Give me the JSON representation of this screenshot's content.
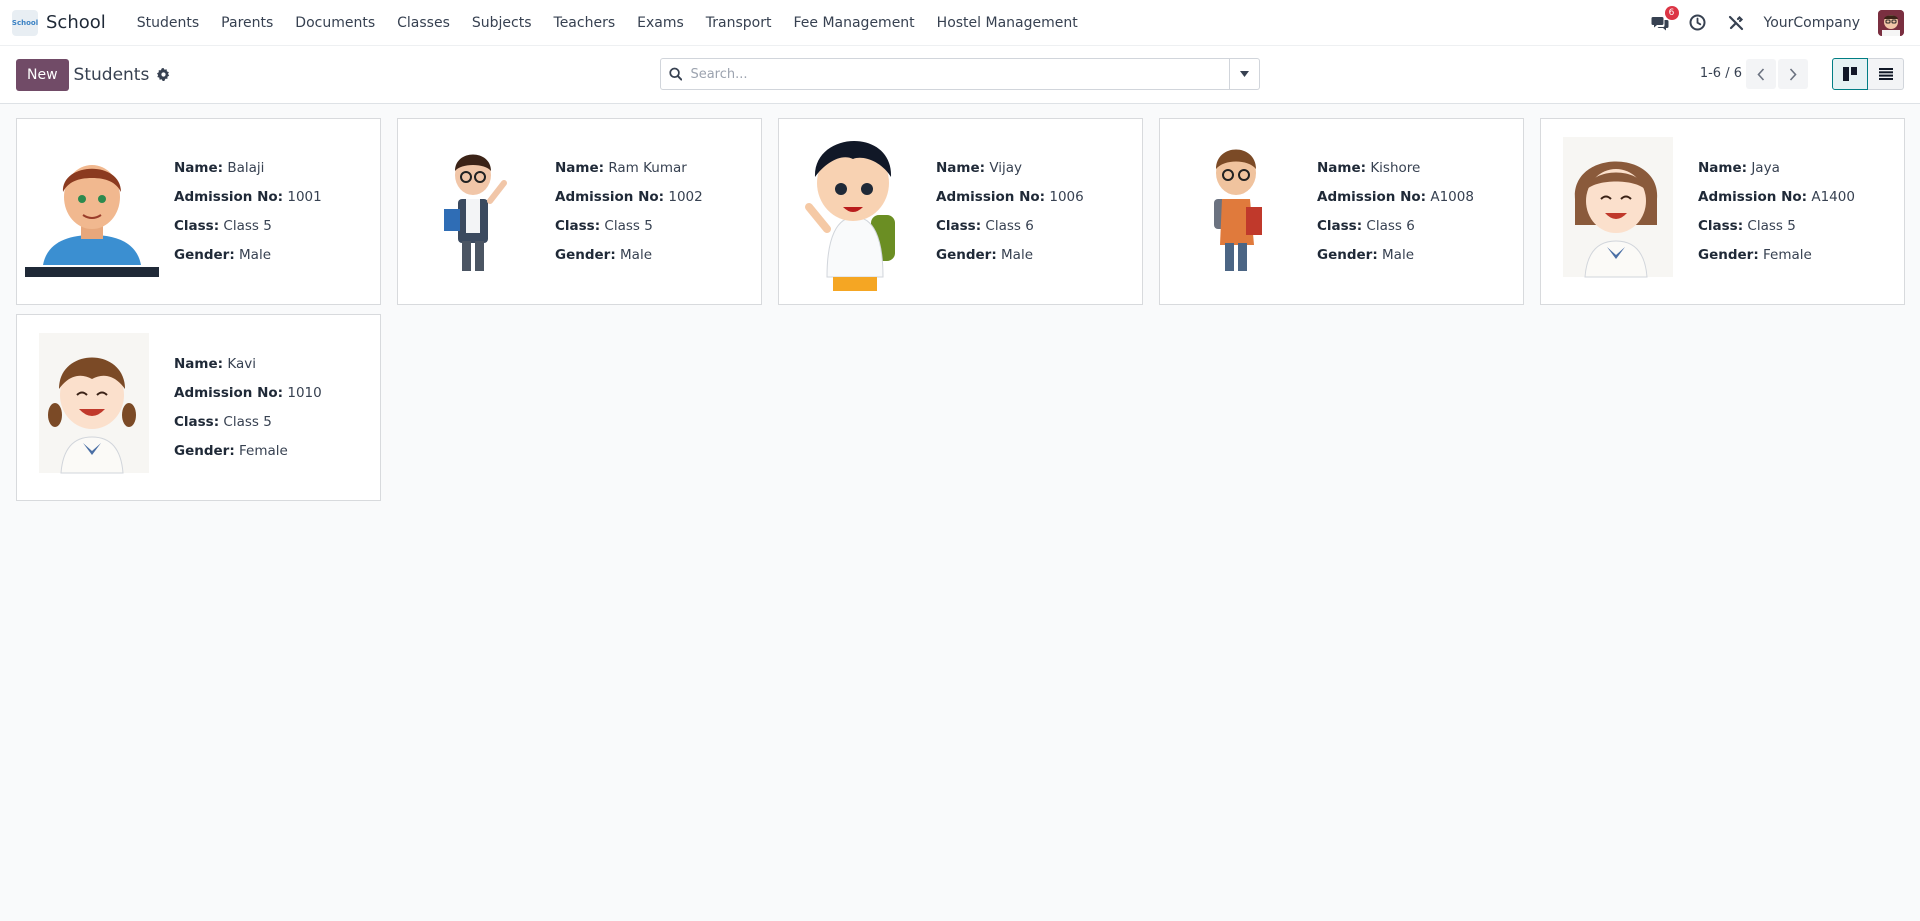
{
  "navbar": {
    "app_name": "School",
    "app_logo_text": "School",
    "menu": [
      "Students",
      "Parents",
      "Documents",
      "Classes",
      "Subjects",
      "Teachers",
      "Exams",
      "Transport",
      "Fee Management",
      "Hostel Management"
    ],
    "messages_count": "6",
    "company": "YourCompany"
  },
  "control_panel": {
    "new_label": "New",
    "title": "Students",
    "search_placeholder": "Search...",
    "pager": "1-6 / 6"
  },
  "labels": {
    "name": "Name:",
    "admission": "Admission No:",
    "class": "Class:",
    "gender": "Gender:"
  },
  "students": [
    {
      "name": "Balaji",
      "admission_no": "1001",
      "class": "Class 5",
      "gender": "Male",
      "avatar": "boy-red-hair"
    },
    {
      "name": "Ram Kumar",
      "admission_no": "1002",
      "class": "Class 5",
      "gender": "Male",
      "avatar": "boy-glasses-book"
    },
    {
      "name": "Vijay",
      "admission_no": "1006",
      "class": "Class 6",
      "gender": "Male",
      "avatar": "boy-waving-backpack"
    },
    {
      "name": "Kishore",
      "admission_no": "A1008",
      "class": "Class 6",
      "gender": "Male",
      "avatar": "boy-glasses-backpack"
    },
    {
      "name": "Jaya",
      "admission_no": "A1400",
      "class": "Class 5",
      "gender": "Female",
      "avatar": "girl-short-hair"
    },
    {
      "name": "Kavi",
      "admission_no": "1010",
      "class": "Class 5",
      "gender": "Female",
      "avatar": "girl-pigtails"
    }
  ],
  "colors": {
    "primary": "#714b67",
    "accent": "#017e84",
    "badge": "#dc3545"
  }
}
